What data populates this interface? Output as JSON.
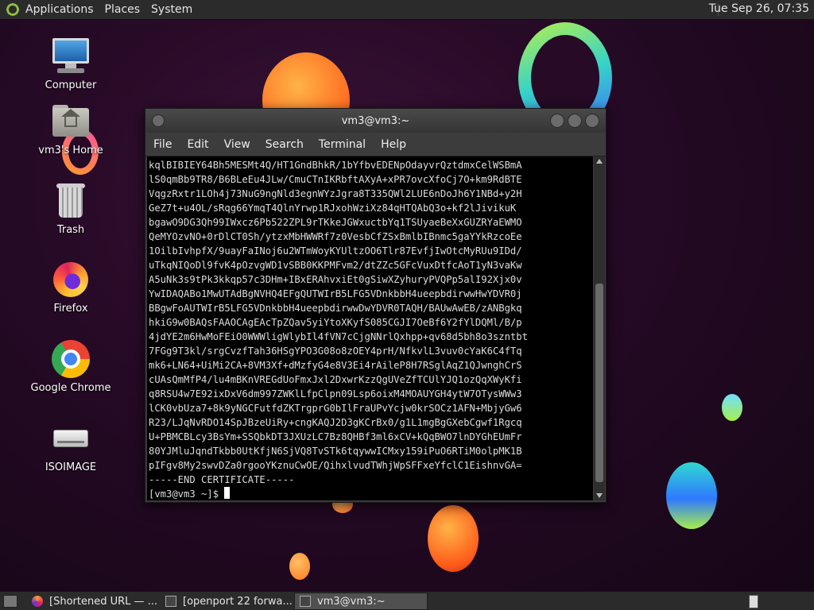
{
  "top_panel": {
    "menus": [
      "Applications",
      "Places",
      "System"
    ],
    "clock": "Tue Sep 26, 07:35"
  },
  "desktop_icons": [
    {
      "label": "Computer",
      "icon": "computer-icon"
    },
    {
      "label": "vm3's Home",
      "icon": "home-folder-icon"
    },
    {
      "label": "Trash",
      "icon": "trash-icon"
    },
    {
      "label": "Firefox",
      "icon": "firefox-icon"
    },
    {
      "label": "Google Chrome",
      "icon": "chrome-icon"
    },
    {
      "label": "ISOIMAGE",
      "icon": "drive-icon"
    }
  ],
  "terminal": {
    "title": "vm3@vm3:~",
    "menu": [
      "File",
      "Edit",
      "View",
      "Search",
      "Terminal",
      "Help"
    ],
    "lines": [
      "kqlBIBIEY64Bh5MESMt4Q/HT1GndBhkR/1bYfbvEDENpOdayvrQztdmxCelWSBmA",
      "lS0qmBb9TR8/B6BLeEu4JLw/CmuCTnIKRbftAXyA+xPR7ovcXfoCj7O+km9RdBTE",
      "VqgzRxtr1LOh4j73NuG9ngNld3egnWYzJgra8T335QWl2LUE6nDoJh6Y1NBd+y2H",
      "GeZ7t+u4OL/sRqg66YmqT4QlnYrwp1RJxohWziXz84qHTQAbQ3o+kf2lJivikuK",
      "bgawO9DG3Qh99IWxcz6Pb522ZPL9rTKkeJGWxuctbYq1TSUyaeBeXxGUZRYaEWMO",
      "QeMYOzvNO+0rDlCT0Sh/ytzxMbHWWRf7z0VesbCfZSxBmlbIBnmc5gaYYkRzcoEe",
      "1OilbIvhpfX/9uayFaINoj6u2WTmWoyKYUltzOO6Tlr87EvfjIwOtcMyRUu9IDd/",
      "uTkqNIQoDl9fvK4pOzvgWD1vSBB0KKPMFvm2/dtZZc5GFcVuxDtfcAoT1yN3vaKw",
      "A5uNk3s9tPk3kkqp57c3DHm+IBxERAhvxiEt0gSiwXZyhuryPVQPp5alI92Xjx0v",
      "YwIDAQABo1MwUTAdBgNVHQ4EFgQUTWIrB5LFG5VDnkbbH4ueepbdirwwHwYDVR0j",
      "BBgwFoAUTWIrB5LFG5VDnkbbH4ueepbdirwwDwYDVR0TAQH/BAUwAwEB/zANBgkq",
      "hkiG9w0BAQsFAAOCAgEAcTpZQav5yiYtoXKyfS085CGJI7OeBf6Y2fYlDQMl/B/p",
      "4jdYE2m6HwMoFEiO0WWWligWlybIl4fVN7cCjgNNrlQxhpp+qv68d5bh8o3szntbt",
      "7FGg9T3kl/srgCvzfTah36HSgYPO3G08o8zOEY4prH/NfkvlL3vuv0cYaK6C4fTq",
      "mk6+LN64+UiMi2CA+8VM3Xf+dMzfyG4e8V3Ei4rAileP8H7RSglAqZ1QJwnghCrS",
      "cUAsQmMfP4/lu4mBKnVREGdUoFmxJxl2DxwrKzzQgUVeZfTCUlYJQ1ozQqXWyKfi",
      "q8RSU4w7E92ixDxV6dm997ZWKlLfpClpn09Lsp6oixM4MOAUYGH4ytW7OTysWWw3",
      "lCK0vbUza7+8k9yNGCFutfdZKTrgprG0bIlFraUPvYcjw0krSOCz1AFN+MbjyGw6",
      "R23/LJqNvRDO14SpJBzeUiRy+cngKAQJ2D3gKCrBx0/g1L1mgBgGXebCgwf1Rgcq",
      "U+PBMCBLcy3BsYm+SSQbkDT3JXUzLC7Bz8QHBf3ml6xCV+kQqBWO7lnDYGhEUmFr",
      "80YJMluJqndTkbb0UtKfjN6SjVQ8TvSTk6tqywwICMxy159iPuO6RTiM0olpMK1B",
      "pIFgv8My2swvDZa0rgooYKznuCwOE/QihxlvudTWhjWpSFFxeYfclC1EishnvGA=",
      "-----END CERTIFICATE-----"
    ],
    "prompt": "[vm3@vm3 ~]$ "
  },
  "taskbar": {
    "tasks": [
      {
        "label": "[Shortened URL — ...",
        "icon": "firefox-icon"
      },
      {
        "label": "[openport 22 forwa...",
        "icon": "terminal-icon"
      },
      {
        "label": "vm3@vm3:~",
        "icon": "terminal-icon",
        "active": true
      }
    ]
  }
}
